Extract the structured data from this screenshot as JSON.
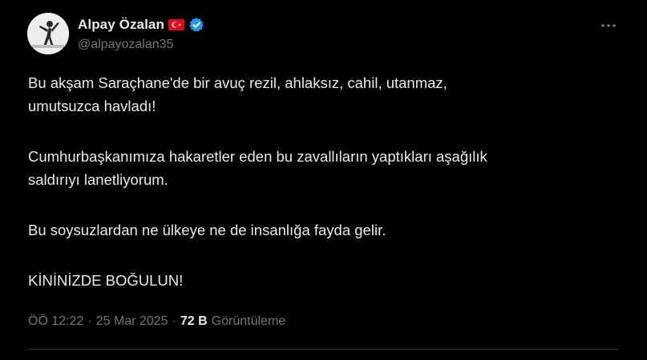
{
  "author": {
    "display_name": "Alpay Özalan",
    "handle": "@alpayozalan35",
    "flag_icon": "turkey-flag-icon",
    "verified_icon": "verified-badge-icon",
    "verified_color": "#1d9bf0"
  },
  "tweet": {
    "paragraphs": [
      "Bu akşam Saraçhane'de bir avuç rezil, ahlaksız, cahil, utanmaz,\numutsuzca havladı!",
      "Cumhurbaşkanımıza hakaretler eden bu zavallıların yaptıkları aşağılık\nsaldırıyı lanetliyorum.",
      "Bu soysuzlardan ne ülkeye ne de insanlığa fayda gelir.",
      "KİNİNİZDE BOĞULUN!"
    ]
  },
  "meta": {
    "time": "ÖÖ 12:22",
    "separator_1": "·",
    "date": "25 Mar 2025",
    "separator_2": "·",
    "views_count": "72 B",
    "views_label": "Görüntüleme"
  },
  "icons": {
    "more": "more-options-icon"
  },
  "colors": {
    "background": "#000000",
    "text_primary": "#e7e9ea",
    "text_secondary": "#71767b",
    "divider": "#2f3336",
    "flag_red": "#e30a17"
  }
}
